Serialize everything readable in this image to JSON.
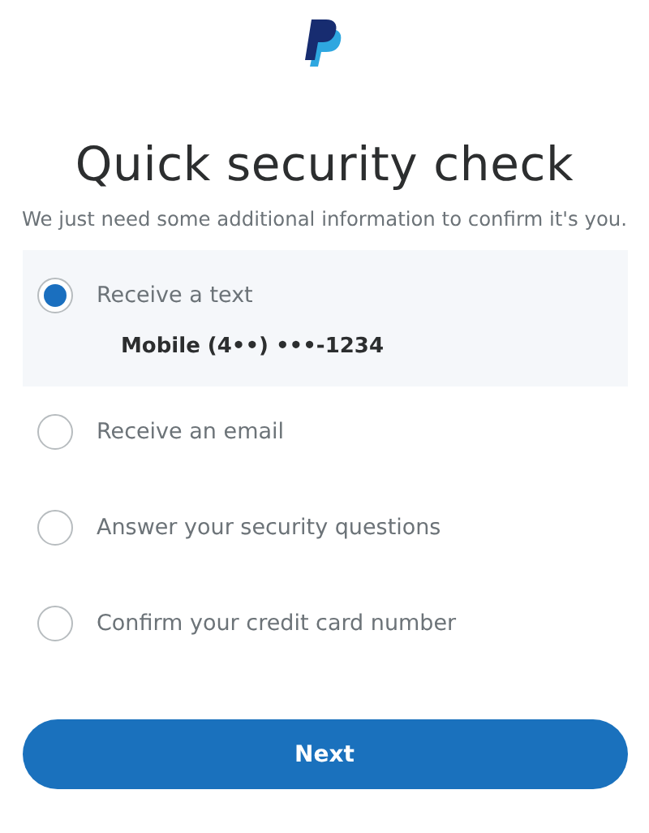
{
  "title": "Quick security check",
  "subtitle": "We just need some additional information to confirm it's you.",
  "options": [
    {
      "label": "Receive a text",
      "detail": "Mobile (4••) •••-1234",
      "selected": true
    },
    {
      "label": "Receive an email",
      "selected": false
    },
    {
      "label": "Answer your security questions",
      "selected": false
    },
    {
      "label": "Confirm your credit card number",
      "selected": false
    }
  ],
  "button": "Next"
}
